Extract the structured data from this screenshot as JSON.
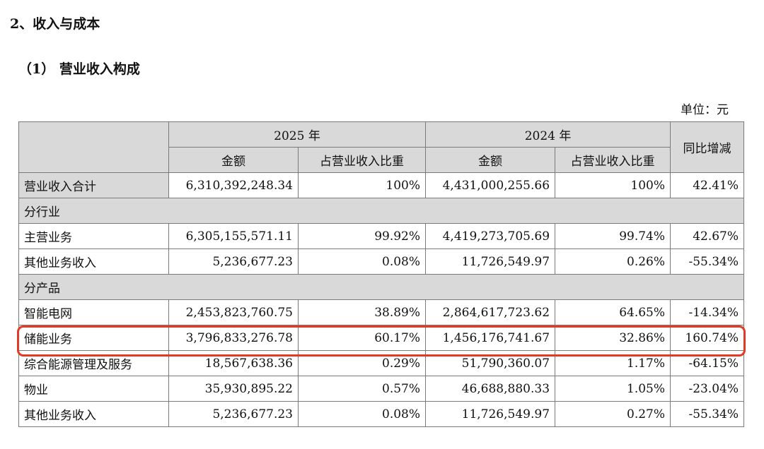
{
  "section_heading": "2、收入与成本",
  "sub_heading": "（1）  营业收入构成",
  "unit_label": "单位：元",
  "table": {
    "year_current": "2025 年",
    "year_previous": "2024 年",
    "col_amount": "金额",
    "col_ratio": "占营业收入比重",
    "col_yoy": "同比增减",
    "total": {
      "label": "营业收入合计",
      "amount_2025": "6,310,392,248.34",
      "ratio_2025": "100%",
      "amount_2024": "4,431,000,255.66",
      "ratio_2024": "100%",
      "yoy": "42.41%"
    },
    "section_industry": "分行业",
    "industry_rows": [
      {
        "label": "主营业务",
        "amount_2025": "6,305,155,571.11",
        "ratio_2025": "99.92%",
        "amount_2024": "4,419,273,705.69",
        "ratio_2024": "99.74%",
        "yoy": "42.67%"
      },
      {
        "label": "其他业务收入",
        "amount_2025": "5,236,677.23",
        "ratio_2025": "0.08%",
        "amount_2024": "11,726,549.97",
        "ratio_2024": "0.26%",
        "yoy": "-55.34%"
      }
    ],
    "section_product": "分产品",
    "product_rows": [
      {
        "label": "智能电网",
        "amount_2025": "2,453,823,760.75",
        "ratio_2025": "38.89%",
        "amount_2024": "2,864,617,723.62",
        "ratio_2024": "64.65%",
        "yoy": "-14.34%"
      },
      {
        "label": "储能业务",
        "amount_2025": "3,796,833,276.78",
        "ratio_2025": "60.17%",
        "amount_2024": "1,456,176,741.67",
        "ratio_2024": "32.86%",
        "yoy": "160.74%"
      },
      {
        "label": "综合能源管理及服务",
        "amount_2025": "18,567,638.36",
        "ratio_2025": "0.29%",
        "amount_2024": "51,790,360.07",
        "ratio_2024": "1.17%",
        "yoy": "-64.15%"
      },
      {
        "label": "物业",
        "amount_2025": "35,930,895.22",
        "ratio_2025": "0.57%",
        "amount_2024": "46,688,880.33",
        "ratio_2024": "1.05%",
        "yoy": "-23.04%"
      },
      {
        "label": "其他业务收入",
        "amount_2025": "5,236,677.23",
        "ratio_2025": "0.08%",
        "amount_2024": "11,726,549.97",
        "ratio_2024": "0.27%",
        "yoy": "-55.34%"
      }
    ]
  },
  "highlight_color": "#e23a24"
}
